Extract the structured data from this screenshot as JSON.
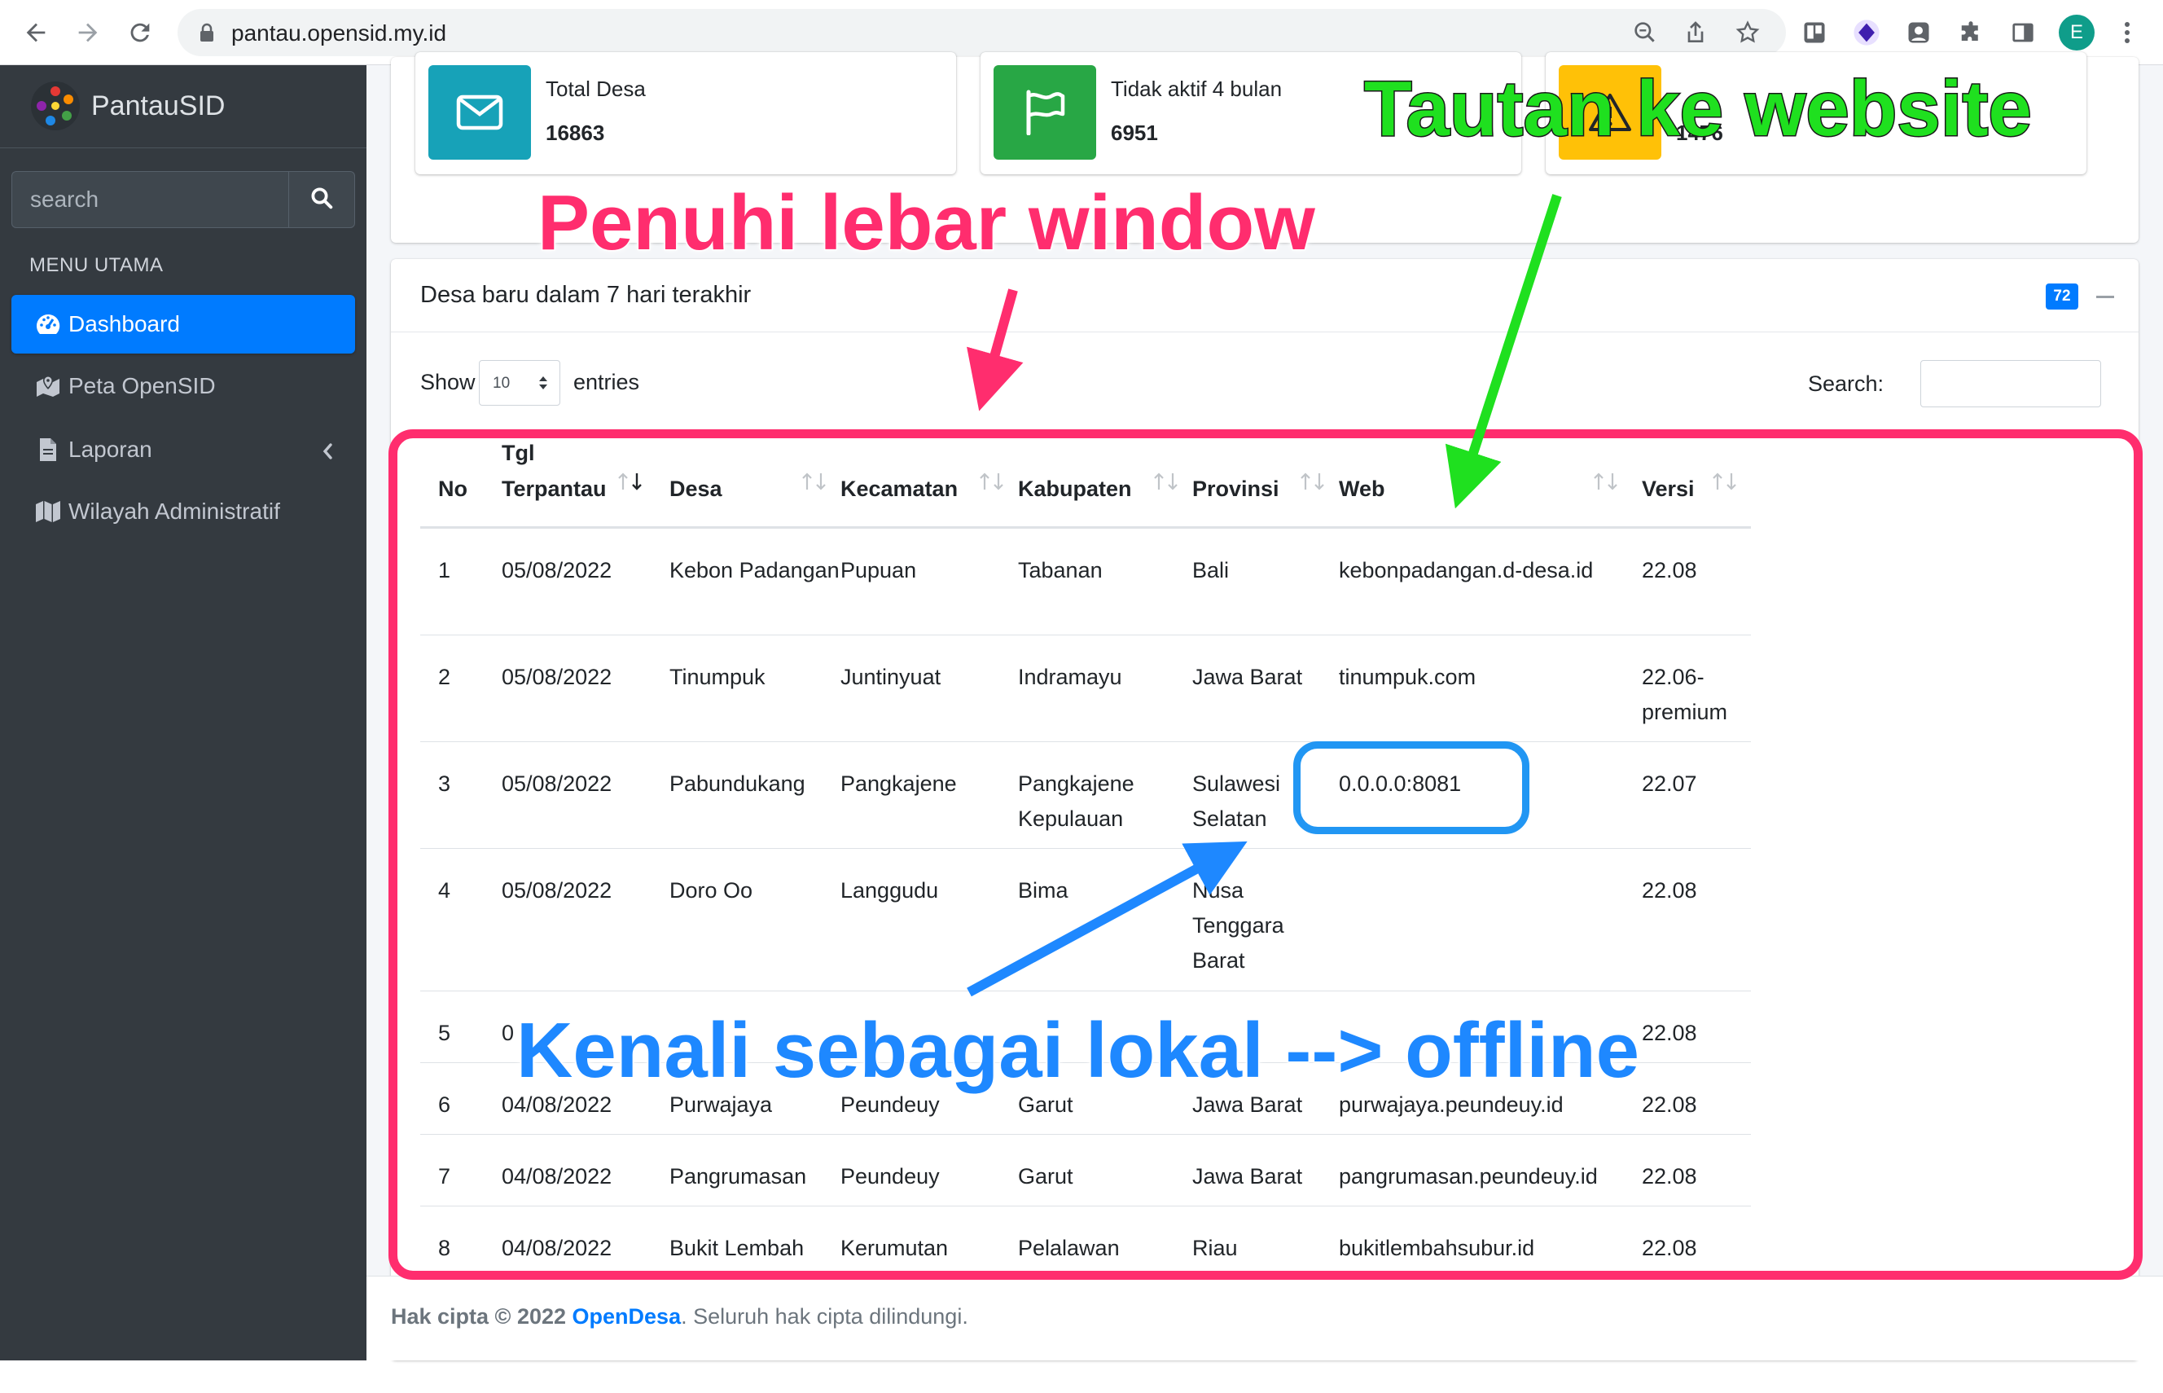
{
  "browser": {
    "url": "pantau.opensid.my.id",
    "profile_initial": "E"
  },
  "sidebar": {
    "brand": "PantauSID",
    "search_placeholder": "search",
    "menu_header": "MENU UTAMA",
    "items": [
      {
        "label": "Dashboard",
        "icon": "tachometer-icon",
        "active": true
      },
      {
        "label": "Peta OpenSID",
        "icon": "map-marker-icon",
        "active": false
      },
      {
        "label": "Laporan",
        "icon": "file-icon",
        "active": false
      },
      {
        "label": "Wilayah Administratif",
        "icon": "map-icon",
        "active": false
      }
    ]
  },
  "stats": [
    {
      "label": "Total Desa",
      "value": "16863",
      "icon": "envelope-icon",
      "color": "#17a2b8"
    },
    {
      "label": "Tidak aktif 4 bulan",
      "value": "6951",
      "icon": "flag-icon",
      "color": "#28a745"
    },
    {
      "label": "",
      "value": "1476",
      "icon": "warning-icon",
      "color": "#ffc107"
    }
  ],
  "card": {
    "title": "Desa baru dalam 7 hari terakhir",
    "badge": "72",
    "show_label": "Show",
    "length_value": "10",
    "entries_label": "entries",
    "search_label": "Search:"
  },
  "table": {
    "columns": [
      "No",
      "Tgl Terpantau",
      "Desa",
      "Kecamatan",
      "Kabupaten",
      "Provinsi",
      "Web",
      "Versi"
    ],
    "rows": [
      [
        "1",
        "05/08/2022",
        "Kebon Padangan",
        "Pupuan",
        "Tabanan",
        "Bali",
        "kebonpadangan.d-desa.id",
        "22.08"
      ],
      [
        "2",
        "05/08/2022",
        "Tinumpuk",
        "Juntinyuat",
        "Indramayu",
        "Jawa Barat",
        "tinumpuk.com",
        "22.06-premium"
      ],
      [
        "3",
        "05/08/2022",
        "Pabundukang",
        "Pangkajene",
        "Pangkajene Kepulauan",
        "Sulawesi Selatan",
        "0.0.0.0:8081",
        "22.07"
      ],
      [
        "4",
        "05/08/2022",
        "Doro Oo",
        "Langgudu",
        "Bima",
        "Nusa Tenggara Barat",
        "",
        "22.08"
      ],
      [
        "5",
        "0",
        "",
        "",
        "",
        "",
        "",
        "22.08"
      ],
      [
        "6",
        "04/08/2022",
        "Purwajaya",
        "Peundeuy",
        "Garut",
        "Jawa Barat",
        "purwajaya.peundeuy.id",
        "22.08"
      ],
      [
        "7",
        "04/08/2022",
        "Pangrumasan",
        "Peundeuy",
        "Garut",
        "Jawa Barat",
        "pangrumasan.peundeuy.id",
        "22.08"
      ],
      [
        "8",
        "04/08/2022",
        "Bukit Lembah",
        "Kerumutan",
        "Pelalawan",
        "Riau",
        "bukitlembahsubur.id",
        "22.08"
      ]
    ]
  },
  "footer": {
    "prefix": "Hak cipta © 2022",
    "link": "OpenDesa",
    "suffix": ". Seluruh hak cipta dilindungi."
  },
  "annotations": {
    "fill_width": "Penuhi lebar window",
    "link_to_website": "Tautan ke website",
    "local_offline": "Kenali sebagai lokal --> offline",
    "colors": {
      "pink": "#ff2d6e",
      "green": "#1fe01f",
      "blue": "#1e88ff"
    }
  }
}
